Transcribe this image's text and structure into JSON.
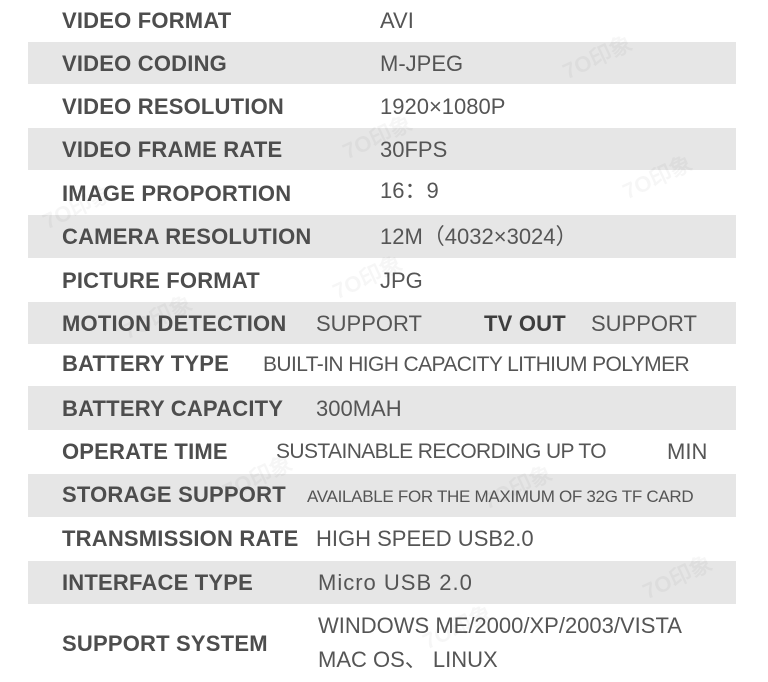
{
  "specs": [
    {
      "label": "VIDEO FORMAT",
      "value": "AVI"
    },
    {
      "label": "VIDEO CODING",
      "value": "M-JPEG"
    },
    {
      "label": "VIDEO RESOLUTION",
      "value": "1920×1080P"
    },
    {
      "label": "VIDEO FRAME RATE",
      "value": "30FPS"
    },
    {
      "label": "IMAGE PROPORTION",
      "value": "16：9"
    },
    {
      "label": "CAMERA RESOLUTION",
      "value": "12M（4032×3024）"
    },
    {
      "label": "PICTURE FORMAT",
      "value": "JPG"
    },
    {
      "label": "MOTION DETECTION",
      "value": "SUPPORT",
      "label2": "TV OUT",
      "value2": "SUPPORT"
    },
    {
      "label": "BATTERY TYPE",
      "value": "BUILT-IN HIGH CAPACITY LITHIUM POLYMER"
    },
    {
      "label": "BATTERY CAPACITY",
      "value": "300MAH"
    },
    {
      "label": "OPERATE TIME",
      "value": "SUSTAINABLE RECORDING UP TO",
      "value2": "MIN"
    },
    {
      "label": "STORAGE SUPPORT",
      "value": "AVAILABLE FOR THE MAXIMUM OF 32G TF CARD"
    },
    {
      "label": "TRANSMISSION RATE",
      "value": "HIGH SPEED USB2.0"
    },
    {
      "label": "INTERFACE TYPE",
      "value": "Micro USB 2.0"
    },
    {
      "label": "SUPPORT SYSTEM",
      "value": "WINDOWS ME/2000/XP/2003/VISTA",
      "value2": "MAC OS、 LINUX"
    }
  ],
  "watermark": "7О印象"
}
